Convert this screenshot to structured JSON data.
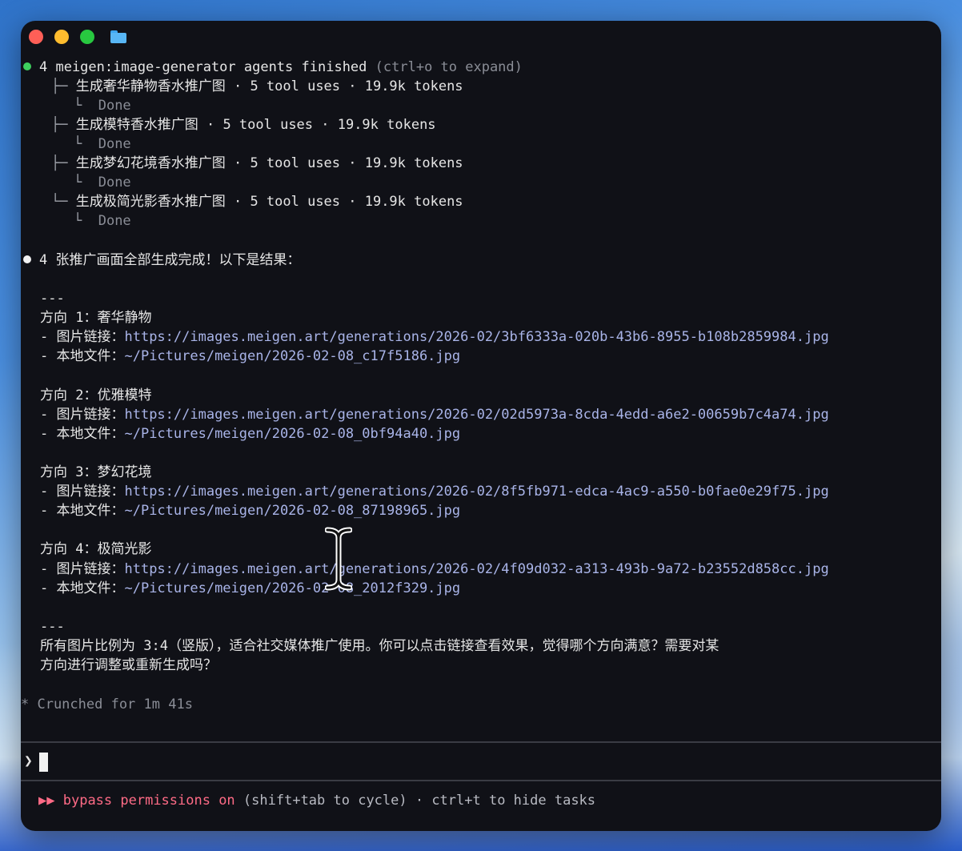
{
  "window": {
    "traffic_lights": [
      "close",
      "minimize",
      "zoom"
    ],
    "folder_icon": "folder-icon"
  },
  "agents": {
    "header_main": "4 meigen:image-generator agents finished",
    "header_hint": "(ctrl+o to expand)",
    "tasks": [
      {
        "name": "生成奢华静物香水推广图",
        "stats": "· 5 tool uses · 19.9k tokens",
        "status": "Done"
      },
      {
        "name": "生成模特香水推广图",
        "stats": "· 5 tool uses · 19.9k tokens",
        "status": "Done"
      },
      {
        "name": "生成梦幻花境香水推广图",
        "stats": "· 5 tool uses · 19.9k tokens",
        "status": "Done"
      },
      {
        "name": "生成极简光影香水推广图",
        "stats": "· 5 tool uses · 19.9k tokens",
        "status": "Done"
      }
    ]
  },
  "message": {
    "intro": "4 张推广画面全部生成完成！以下是结果：",
    "divider": "---",
    "image_link_label": "- 图片链接：",
    "local_file_label": "- 本地文件：",
    "directions": [
      {
        "title": "方向 1：奢华静物",
        "url": "https://images.meigen.art/generations/2026-02/3bf6333a-020b-43b6-8955-b108b2859984.jpg",
        "file": "~/Pictures/meigen/2026-02-08_c17f5186.jpg"
      },
      {
        "title": "方向 2：优雅模特",
        "url": "https://images.meigen.art/generations/2026-02/02d5973a-8cda-4edd-a6e2-00659b7c4a74.jpg",
        "file": "~/Pictures/meigen/2026-02-08_0bf94a40.jpg"
      },
      {
        "title": "方向 3：梦幻花境",
        "url": "https://images.meigen.art/generations/2026-02/8f5fb971-edca-4ac9-a550-b0fae0e29f75.jpg",
        "file": "~/Pictures/meigen/2026-02-08_87198965.jpg"
      },
      {
        "title": "方向 4：极简光影",
        "url": "https://images.meigen.art/generations/2026-02/4f09d032-a313-493b-9a72-b23552d858cc.jpg",
        "file": "~/Pictures/meigen/2026-02-08_2012f329.jpg"
      }
    ],
    "closing_line1": "所有图片比例为 3:4（竖版），适合社交媒体推广使用。你可以点击链接查看效果，觉得哪个方向满意？需要对某",
    "closing_line2": "方向进行调整或重新生成吗？"
  },
  "status": {
    "crunched": "* Crunched for 1m 41s"
  },
  "input": {
    "prompt_symbol": "❯"
  },
  "footer": {
    "mode_icon": "▶▶",
    "mode_text": "bypass permissions on",
    "hint": "(shift+tab to cycle) · ctrl+t to hide tasks"
  }
}
